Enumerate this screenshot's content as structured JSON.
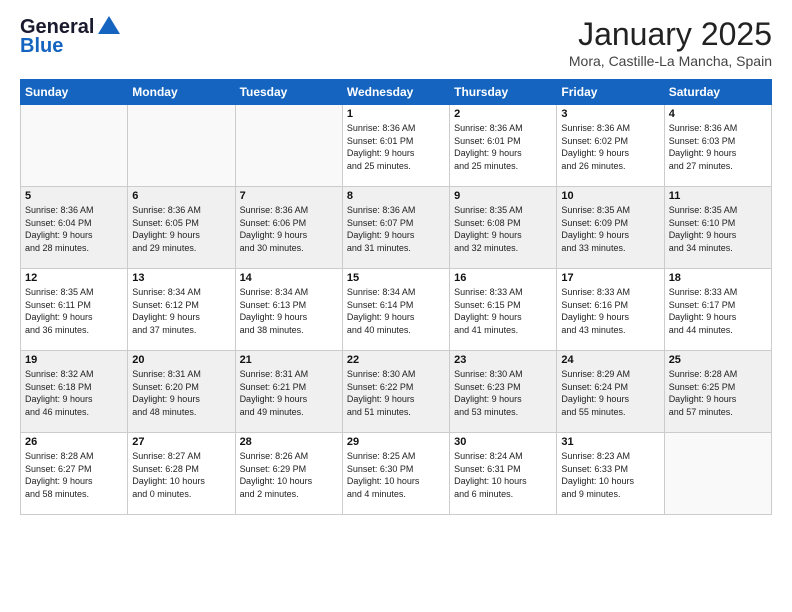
{
  "header": {
    "logo_line1": "General",
    "logo_line2": "Blue",
    "month": "January 2025",
    "location": "Mora, Castille-La Mancha, Spain"
  },
  "weekdays": [
    "Sunday",
    "Monday",
    "Tuesday",
    "Wednesday",
    "Thursday",
    "Friday",
    "Saturday"
  ],
  "weeks": [
    [
      {
        "day": "",
        "info": ""
      },
      {
        "day": "",
        "info": ""
      },
      {
        "day": "",
        "info": ""
      },
      {
        "day": "1",
        "info": "Sunrise: 8:36 AM\nSunset: 6:01 PM\nDaylight: 9 hours\nand 25 minutes."
      },
      {
        "day": "2",
        "info": "Sunrise: 8:36 AM\nSunset: 6:01 PM\nDaylight: 9 hours\nand 25 minutes."
      },
      {
        "day": "3",
        "info": "Sunrise: 8:36 AM\nSunset: 6:02 PM\nDaylight: 9 hours\nand 26 minutes."
      },
      {
        "day": "4",
        "info": "Sunrise: 8:36 AM\nSunset: 6:03 PM\nDaylight: 9 hours\nand 27 minutes."
      }
    ],
    [
      {
        "day": "5",
        "info": "Sunrise: 8:36 AM\nSunset: 6:04 PM\nDaylight: 9 hours\nand 28 minutes."
      },
      {
        "day": "6",
        "info": "Sunrise: 8:36 AM\nSunset: 6:05 PM\nDaylight: 9 hours\nand 29 minutes."
      },
      {
        "day": "7",
        "info": "Sunrise: 8:36 AM\nSunset: 6:06 PM\nDaylight: 9 hours\nand 30 minutes."
      },
      {
        "day": "8",
        "info": "Sunrise: 8:36 AM\nSunset: 6:07 PM\nDaylight: 9 hours\nand 31 minutes."
      },
      {
        "day": "9",
        "info": "Sunrise: 8:35 AM\nSunset: 6:08 PM\nDaylight: 9 hours\nand 32 minutes."
      },
      {
        "day": "10",
        "info": "Sunrise: 8:35 AM\nSunset: 6:09 PM\nDaylight: 9 hours\nand 33 minutes."
      },
      {
        "day": "11",
        "info": "Sunrise: 8:35 AM\nSunset: 6:10 PM\nDaylight: 9 hours\nand 34 minutes."
      }
    ],
    [
      {
        "day": "12",
        "info": "Sunrise: 8:35 AM\nSunset: 6:11 PM\nDaylight: 9 hours\nand 36 minutes."
      },
      {
        "day": "13",
        "info": "Sunrise: 8:34 AM\nSunset: 6:12 PM\nDaylight: 9 hours\nand 37 minutes."
      },
      {
        "day": "14",
        "info": "Sunrise: 8:34 AM\nSunset: 6:13 PM\nDaylight: 9 hours\nand 38 minutes."
      },
      {
        "day": "15",
        "info": "Sunrise: 8:34 AM\nSunset: 6:14 PM\nDaylight: 9 hours\nand 40 minutes."
      },
      {
        "day": "16",
        "info": "Sunrise: 8:33 AM\nSunset: 6:15 PM\nDaylight: 9 hours\nand 41 minutes."
      },
      {
        "day": "17",
        "info": "Sunrise: 8:33 AM\nSunset: 6:16 PM\nDaylight: 9 hours\nand 43 minutes."
      },
      {
        "day": "18",
        "info": "Sunrise: 8:33 AM\nSunset: 6:17 PM\nDaylight: 9 hours\nand 44 minutes."
      }
    ],
    [
      {
        "day": "19",
        "info": "Sunrise: 8:32 AM\nSunset: 6:18 PM\nDaylight: 9 hours\nand 46 minutes."
      },
      {
        "day": "20",
        "info": "Sunrise: 8:31 AM\nSunset: 6:20 PM\nDaylight: 9 hours\nand 48 minutes."
      },
      {
        "day": "21",
        "info": "Sunrise: 8:31 AM\nSunset: 6:21 PM\nDaylight: 9 hours\nand 49 minutes."
      },
      {
        "day": "22",
        "info": "Sunrise: 8:30 AM\nSunset: 6:22 PM\nDaylight: 9 hours\nand 51 minutes."
      },
      {
        "day": "23",
        "info": "Sunrise: 8:30 AM\nSunset: 6:23 PM\nDaylight: 9 hours\nand 53 minutes."
      },
      {
        "day": "24",
        "info": "Sunrise: 8:29 AM\nSunset: 6:24 PM\nDaylight: 9 hours\nand 55 minutes."
      },
      {
        "day": "25",
        "info": "Sunrise: 8:28 AM\nSunset: 6:25 PM\nDaylight: 9 hours\nand 57 minutes."
      }
    ],
    [
      {
        "day": "26",
        "info": "Sunrise: 8:28 AM\nSunset: 6:27 PM\nDaylight: 9 hours\nand 58 minutes."
      },
      {
        "day": "27",
        "info": "Sunrise: 8:27 AM\nSunset: 6:28 PM\nDaylight: 10 hours\nand 0 minutes."
      },
      {
        "day": "28",
        "info": "Sunrise: 8:26 AM\nSunset: 6:29 PM\nDaylight: 10 hours\nand 2 minutes."
      },
      {
        "day": "29",
        "info": "Sunrise: 8:25 AM\nSunset: 6:30 PM\nDaylight: 10 hours\nand 4 minutes."
      },
      {
        "day": "30",
        "info": "Sunrise: 8:24 AM\nSunset: 6:31 PM\nDaylight: 10 hours\nand 6 minutes."
      },
      {
        "day": "31",
        "info": "Sunrise: 8:23 AM\nSunset: 6:33 PM\nDaylight: 10 hours\nand 9 minutes."
      },
      {
        "day": "",
        "info": ""
      }
    ]
  ]
}
